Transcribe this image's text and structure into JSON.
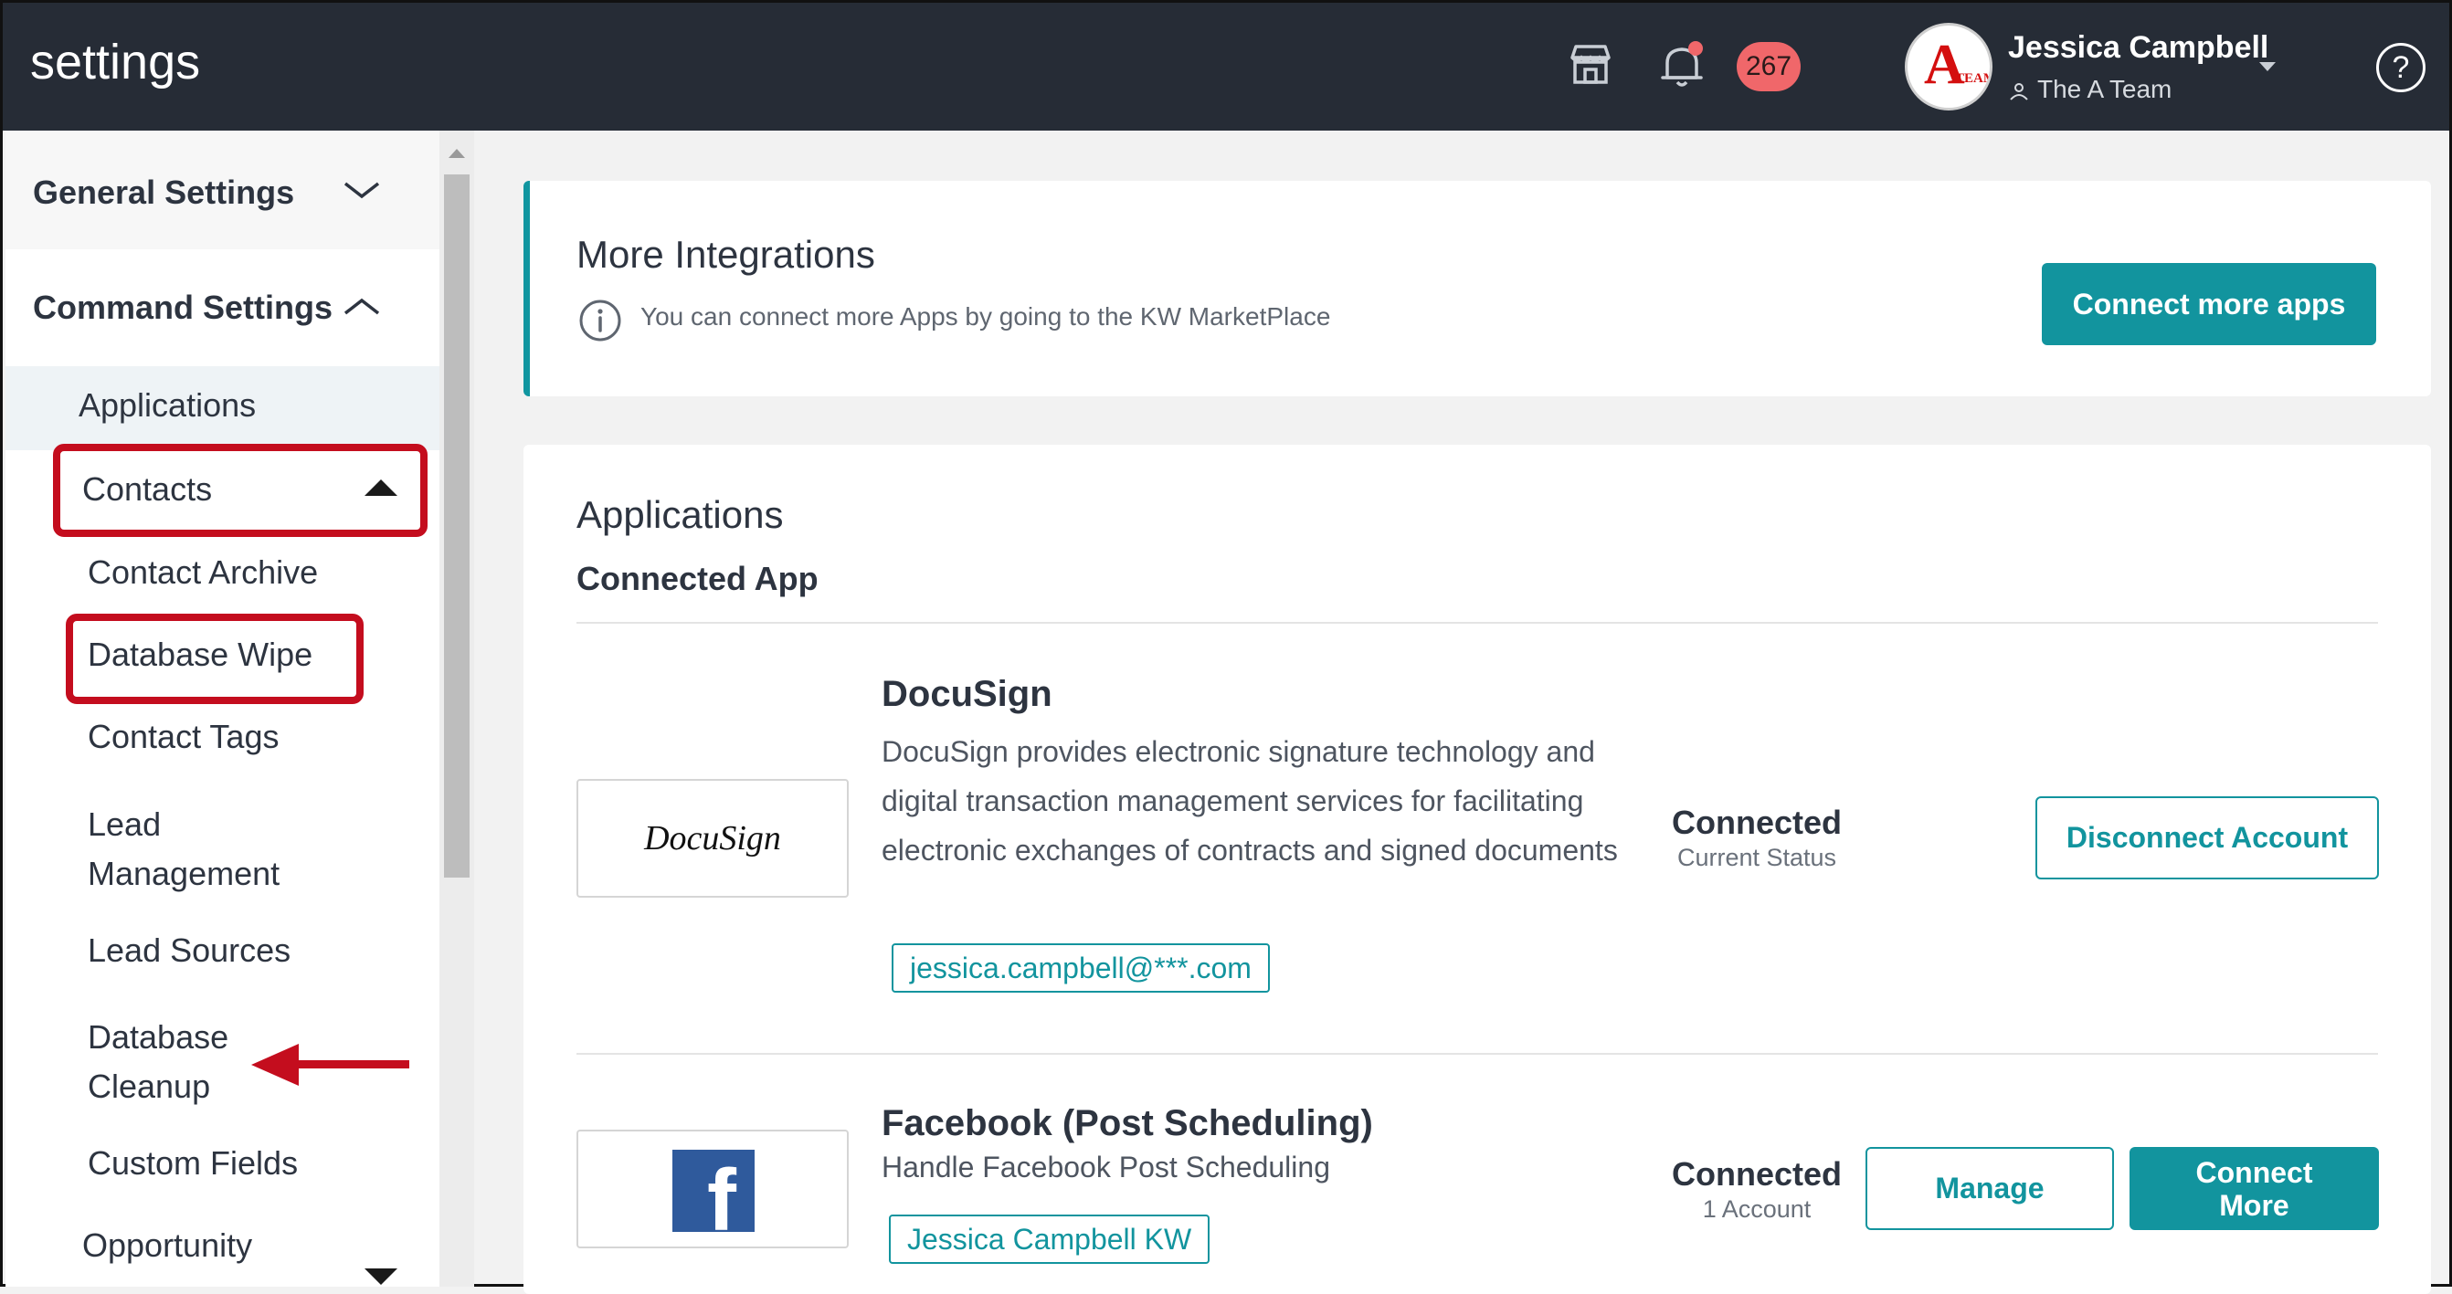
{
  "header": {
    "title": "settings",
    "notification_count": "267",
    "user_name": "Jessica Campbell",
    "team_name": "The A Team",
    "avatar_letter": "A",
    "avatar_subtext": "TEAM",
    "help_symbol": "?",
    "icons": [
      "storefront-icon",
      "bell-icon",
      "team-icon",
      "caret-down-icon",
      "help-icon"
    ]
  },
  "sidebar": {
    "general_settings": "General Settings",
    "command_settings": "Command Settings",
    "items": [
      {
        "label": "Applications"
      },
      {
        "label": "Contacts"
      },
      {
        "label": "Contact Archive"
      },
      {
        "label": "Database Wipe"
      },
      {
        "label": "Contact Tags"
      },
      {
        "label": "Lead\nManagement"
      },
      {
        "label": "Lead Sources"
      },
      {
        "label": "Database\nCleanup"
      },
      {
        "label": "Custom Fields"
      },
      {
        "label": "Opportunity"
      }
    ]
  },
  "integrations": {
    "title": "More Integrations",
    "info_text": "You can connect more Apps by going to the KW MarketPlace",
    "button_label": "Connect more apps"
  },
  "applications": {
    "title": "Applications",
    "subtitle": "Connected App",
    "apps": [
      {
        "name": "DocuSign",
        "logo_text": "DocuSign",
        "description": "DocuSign provides electronic signature technology and digital transaction management services for facilitating electronic exchanges of contracts and signed documents",
        "account": "jessica.campbell@***.com",
        "status": "Connected",
        "status_sub": "Current Status",
        "action_label": "Disconnect Account"
      },
      {
        "name": "Facebook (Post Scheduling)",
        "logo_text": "f",
        "description": "Handle Facebook Post Scheduling",
        "account": "Jessica Campbell KW",
        "status": "Connected",
        "status_sub": "1 Account",
        "manage_label": "Manage",
        "connect_more_label": "Connect\nMore"
      }
    ]
  },
  "colors": {
    "topbar": "#262c36",
    "accent": "#12949e",
    "highlight": "#c40d1e",
    "badge": "#f0676a",
    "facebook": "#2f5a9c"
  }
}
